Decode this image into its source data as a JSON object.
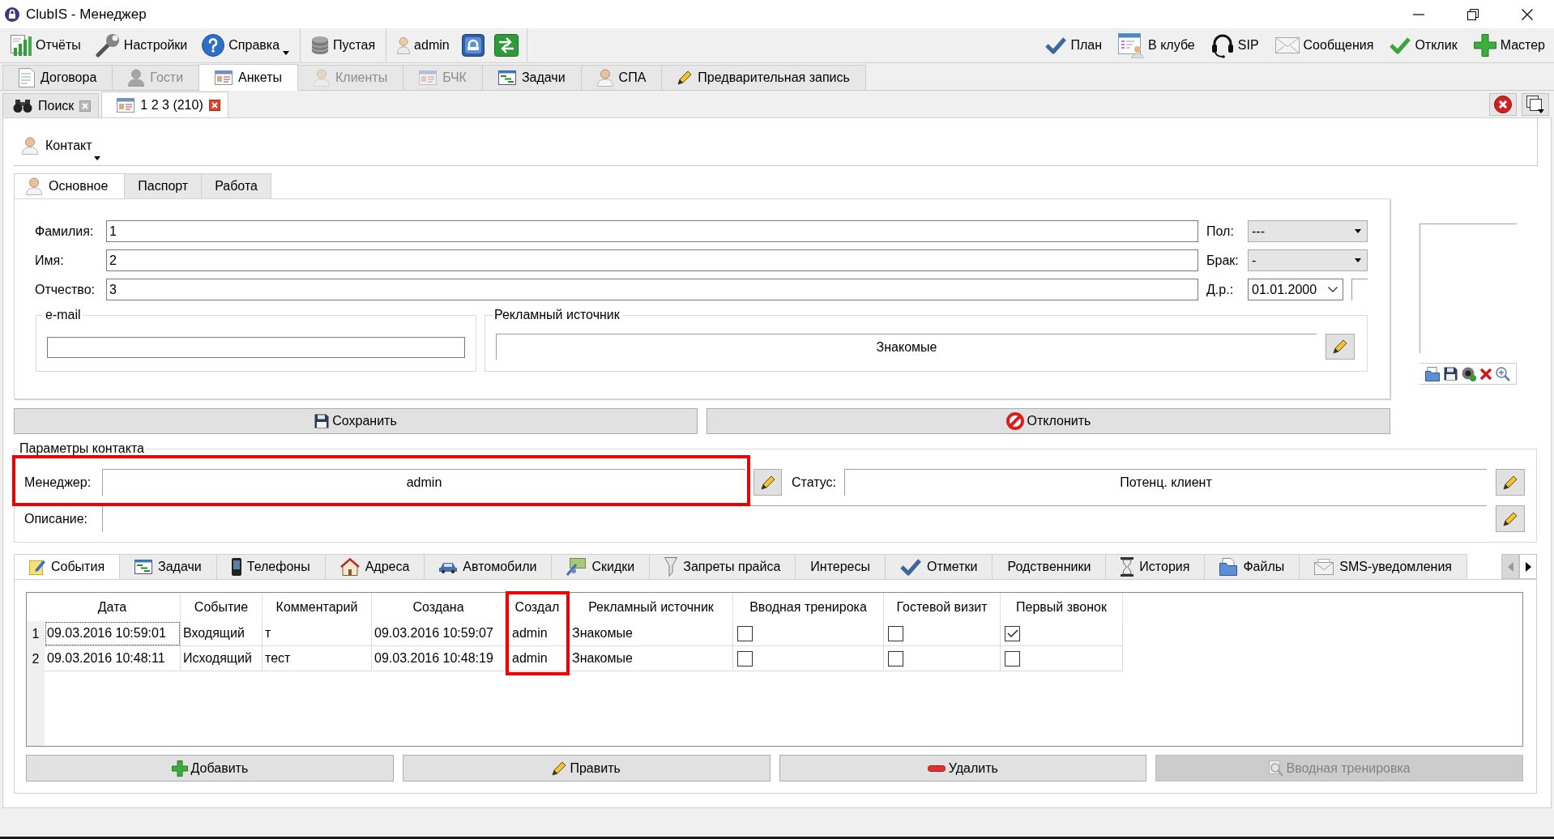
{
  "window": {
    "title": "ClubIS - Менеджер"
  },
  "toolbar": {
    "groups": [
      {
        "items": [
          {
            "label": "Отчёты",
            "dropdown": false
          },
          {
            "label": "Настройки",
            "dropdown": false
          },
          {
            "label": "Справка",
            "dropdown": true
          }
        ]
      },
      {
        "items": [
          {
            "label": "Пустая",
            "dropdown": false
          }
        ]
      },
      {
        "items": [
          {
            "label": "admin",
            "dropdown": false
          }
        ]
      }
    ],
    "right": [
      {
        "label": "План"
      },
      {
        "label": "В клубе"
      },
      {
        "label": "SIP"
      },
      {
        "label": "Сообщения"
      },
      {
        "label": "Отклик"
      },
      {
        "label": "Мастер"
      }
    ]
  },
  "module_tabs": [
    {
      "label": "Договора",
      "selected": false,
      "disabled": false
    },
    {
      "label": "Гости",
      "selected": false,
      "disabled": true
    },
    {
      "label": "Анкеты",
      "selected": true,
      "disabled": false
    },
    {
      "label": "Клиенты",
      "selected": false,
      "disabled": true
    },
    {
      "label": "БЧК",
      "selected": false,
      "disabled": true
    },
    {
      "label": "Задачи",
      "selected": false,
      "disabled": false
    },
    {
      "label": "СПА",
      "selected": false,
      "disabled": false
    },
    {
      "label": "Предварительная запись",
      "selected": false,
      "disabled": false
    }
  ],
  "document_tabs": [
    {
      "label": "Поиск",
      "selected": false
    },
    {
      "label": "1 2 3 (210)",
      "selected": true
    }
  ],
  "contact": {
    "title": "Контакт",
    "dropdown": true,
    "tabs": [
      {
        "label": "Основное",
        "selected": true
      },
      {
        "label": "Паспорт",
        "selected": false
      },
      {
        "label": "Работа",
        "selected": false
      }
    ],
    "name_fields": [
      {
        "label": "Фамилия:",
        "value": "1"
      },
      {
        "label": "Имя:",
        "value": "2"
      },
      {
        "label": "Отчество:",
        "value": "3"
      }
    ],
    "side_fields": [
      {
        "label": "Пол:",
        "value": "---",
        "kind": "combo"
      },
      {
        "label": "Брак:",
        "value": "-",
        "kind": "combo"
      },
      {
        "label": "Д.р.:",
        "value": "01.01.2000",
        "kind": "date"
      }
    ],
    "email": {
      "title": "e-mail"
    },
    "ad_source": {
      "title": "Рекламный источник",
      "value": "Знакомые"
    },
    "actions": [
      {
        "label": "Сохранить"
      },
      {
        "label": "Отклонить"
      }
    ]
  },
  "contact_params": {
    "title": "Параметры контакта",
    "manager": {
      "label": "Менеджер:",
      "value": "admin",
      "highlighted": true
    },
    "status": {
      "label": "Статус:",
      "value": "Потенц. клиент"
    },
    "description": {
      "label": "Описание:"
    }
  },
  "detail_tabs": [
    {
      "label": "События",
      "selected": true
    },
    {
      "label": "Задачи",
      "selected": false
    },
    {
      "label": "Телефоны",
      "selected": false
    },
    {
      "label": "Адреса",
      "selected": false
    },
    {
      "label": "Автомобили",
      "selected": false
    },
    {
      "label": "Скидки",
      "selected": false
    },
    {
      "label": "Запреты прайса",
      "selected": false
    },
    {
      "label": "Интересы",
      "selected": false
    },
    {
      "label": "Отметки",
      "selected": false
    },
    {
      "label": "Родственники",
      "selected": false
    },
    {
      "label": "История",
      "selected": false
    },
    {
      "label": "Файлы",
      "selected": false
    },
    {
      "label": "SMS-уведомления",
      "selected": false
    }
  ],
  "events_table": {
    "columns": [
      {
        "label": "Дата",
        "highlighted": false
      },
      {
        "label": "Событие",
        "highlighted": false
      },
      {
        "label": "Комментарий",
        "highlighted": false
      },
      {
        "label": "Создана",
        "highlighted": false
      },
      {
        "label": "Создал",
        "highlighted": true
      },
      {
        "label": "Рекламный источник",
        "highlighted": false
      },
      {
        "label": "Вводная тренирока",
        "highlighted": false
      },
      {
        "label": "Гостевой визит",
        "highlighted": false
      },
      {
        "label": "Первый звонок",
        "highlighted": false
      }
    ],
    "rows": [
      {
        "number": "1",
        "cells": [
          "09.03.2016 10:59:01",
          "Входящий",
          "т",
          "09.03.2016 10:59:07",
          "admin",
          "Знакомые"
        ],
        "checks": [
          false,
          false,
          true
        ],
        "focused": true
      },
      {
        "number": "2",
        "cells": [
          "09.03.2016 10:48:11",
          "Исходящий",
          "тест",
          "09.03.2016 10:48:19",
          "admin",
          "Знакомые"
        ],
        "checks": [
          false,
          false,
          false
        ],
        "focused": false
      }
    ]
  },
  "table_buttons": [
    {
      "label": "Добавить",
      "disabled": false
    },
    {
      "label": "Править",
      "disabled": false
    },
    {
      "label": "Удалить",
      "disabled": false
    },
    {
      "label": "Вводная тренировка",
      "disabled": true
    }
  ]
}
